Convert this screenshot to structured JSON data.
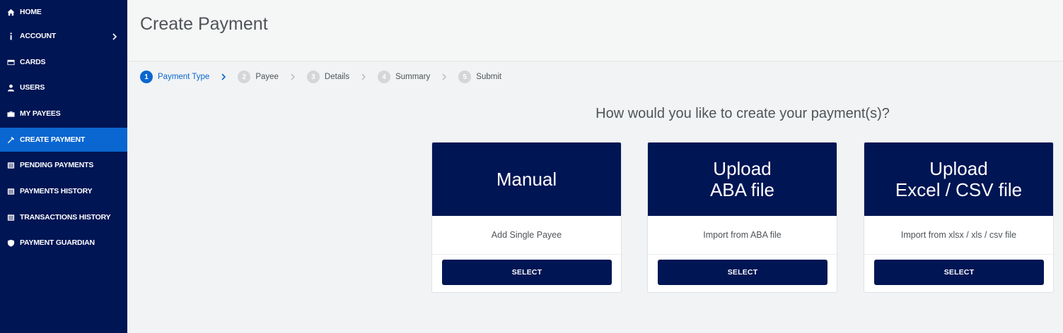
{
  "sidebar": {
    "items": [
      {
        "label": "HOME",
        "icon": "home-icon"
      },
      {
        "label": "ACCOUNT",
        "icon": "info-icon",
        "has_submenu": true
      },
      {
        "label": "CARDS",
        "icon": "card-icon"
      },
      {
        "label": "USERS",
        "icon": "users-icon"
      },
      {
        "label": "MY PAYEES",
        "icon": "briefcase-icon"
      },
      {
        "label": "CREATE PAYMENT",
        "icon": "tools-icon",
        "active": true
      },
      {
        "label": "PENDING PAYMENTS",
        "icon": "list-icon"
      },
      {
        "label": "PAYMENTS HISTORY",
        "icon": "list-icon"
      },
      {
        "label": "TRANSACTIONS HISTORY",
        "icon": "list-icon"
      },
      {
        "label": "PAYMENT GUARDIAN",
        "icon": "shield-icon"
      }
    ]
  },
  "header": {
    "title": "Create Payment"
  },
  "stepper": {
    "steps": [
      {
        "num": "1",
        "label": "Payment Type",
        "active": true
      },
      {
        "num": "2",
        "label": "Payee"
      },
      {
        "num": "3",
        "label": "Details"
      },
      {
        "num": "4",
        "label": "Summary"
      },
      {
        "num": "5",
        "label": "Submit"
      }
    ]
  },
  "main": {
    "question": "How would you like to create your payment(s)?",
    "cards": [
      {
        "title_lines": [
          "Manual"
        ],
        "description": "Add Single Payee",
        "button": "SELECT"
      },
      {
        "title_lines": [
          "Upload",
          "ABA file"
        ],
        "description": "Import from ABA file",
        "button": "SELECT"
      },
      {
        "title_lines": [
          "Upload",
          "Excel / CSV file"
        ],
        "description": "Import from xlsx / xls / csv file",
        "button": "SELECT"
      }
    ]
  },
  "colors": {
    "sidebar_bg": "#001554",
    "active_blue": "#0a66d0",
    "text_gray": "#4f5458"
  }
}
